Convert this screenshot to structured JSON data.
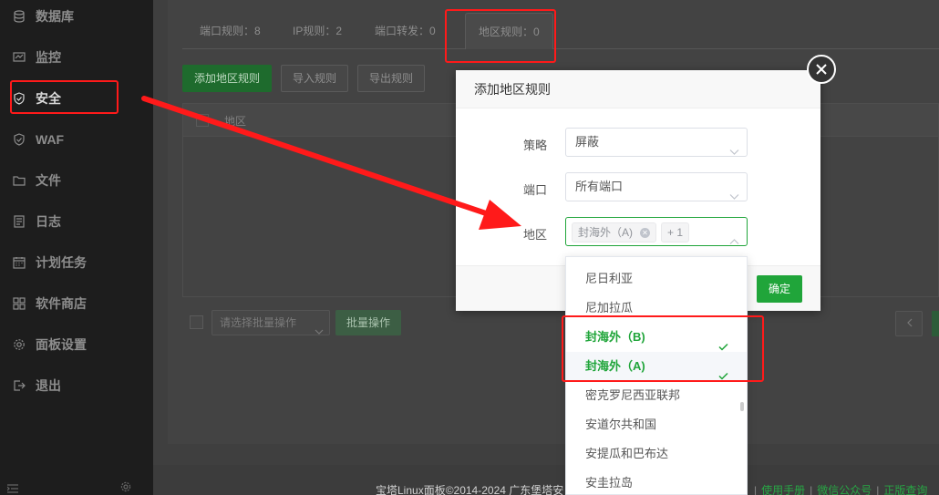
{
  "sidebar": {
    "items": [
      {
        "label": "数据库",
        "icon": "database-icon"
      },
      {
        "label": "监控",
        "icon": "monitor-icon"
      },
      {
        "label": "安全",
        "icon": "shield-icon"
      },
      {
        "label": "WAF",
        "icon": "waf-shield-icon"
      },
      {
        "label": "文件",
        "icon": "folder-icon"
      },
      {
        "label": "日志",
        "icon": "log-icon"
      },
      {
        "label": "计划任务",
        "icon": "calendar-icon"
      },
      {
        "label": "软件商店",
        "icon": "apps-icon"
      },
      {
        "label": "面板设置",
        "icon": "gear-icon"
      },
      {
        "label": "退出",
        "icon": "logout-icon"
      }
    ],
    "active_index": 2
  },
  "tabs": [
    {
      "label": "端口规则：8"
    },
    {
      "label": "IP规则：2"
    },
    {
      "label": "端口转发：0"
    },
    {
      "label": "地区规则：0"
    }
  ],
  "toolbar": {
    "add_label": "添加地区规则",
    "import_label": "导入规则",
    "export_label": "导出规则"
  },
  "table": {
    "columns": [
      "地区"
    ]
  },
  "batch": {
    "placeholder": "请选择批量操作",
    "button_label": "批量操作"
  },
  "footer": {
    "copyright": "宝塔Linux面板©2014-2024 广东堡塔安",
    "links": [
      "使用手册",
      "微信公众号",
      "正版查询"
    ]
  },
  "modal": {
    "title": "添加地区规则",
    "strategy_label": "策略",
    "strategy_value": "屏蔽",
    "port_label": "端口",
    "port_value": "所有端口",
    "region_label": "地区",
    "region_tag": "封海外（A)",
    "region_more": "+ 1",
    "confirm_label": "确定"
  },
  "dropdown": {
    "options": [
      {
        "label": "尼日利亚",
        "selected": false
      },
      {
        "label": "尼加拉瓜",
        "selected": false
      },
      {
        "label": "封海外（B)",
        "selected": true
      },
      {
        "label": "封海外（A)",
        "selected": true
      },
      {
        "label": "密克罗尼西亚联邦",
        "selected": false
      },
      {
        "label": "安道尔共和国",
        "selected": false
      },
      {
        "label": "安提瓜和巴布达",
        "selected": false
      },
      {
        "label": "安圭拉岛",
        "selected": false
      }
    ]
  },
  "colors": {
    "accent": "#20a53a",
    "annotation": "#ff1a1a"
  }
}
